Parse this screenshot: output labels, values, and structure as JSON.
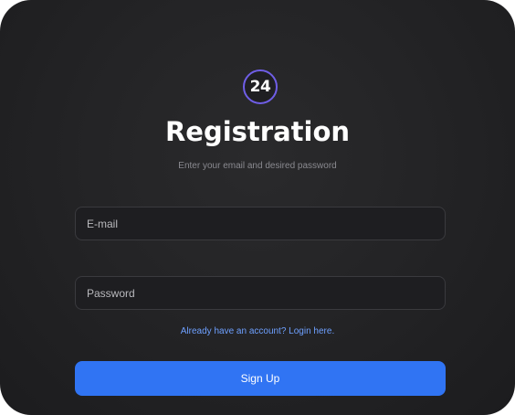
{
  "logo": {
    "text": "24",
    "ring_color": "#6f5ee6"
  },
  "form": {
    "title": "Registration",
    "subtitle": "Enter your email and desired password",
    "email_placeholder": "E-mail",
    "email_value": "",
    "password_placeholder": "Password",
    "password_value": "",
    "login_link": "Already have an account? Login here.",
    "submit_label": "Sign Up"
  },
  "colors": {
    "card_background": "#242426",
    "accent": "#3074f3",
    "link": "#6ea0ff"
  }
}
